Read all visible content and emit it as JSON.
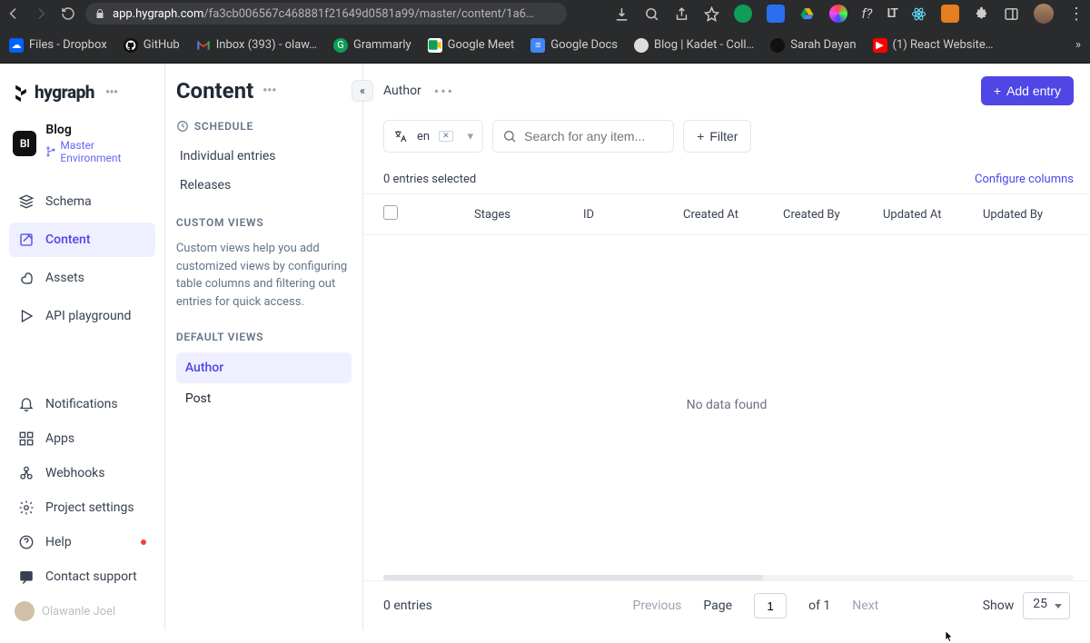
{
  "chrome": {
    "url_host": "app.hygraph.com",
    "url_path": "/fa3cb006567c468881f21649d0581a99/master/content/1a6…"
  },
  "bookmarks": [
    {
      "label": "Files - Dropbox"
    },
    {
      "label": "GitHub"
    },
    {
      "label": "Inbox (393) - olaw…"
    },
    {
      "label": "Grammarly"
    },
    {
      "label": "Google Meet"
    },
    {
      "label": "Google Docs"
    },
    {
      "label": "Blog | Kadet - Coll…"
    },
    {
      "label": "Sarah Dayan"
    },
    {
      "label": "(1) React Website…"
    }
  ],
  "brand": {
    "name": "hygraph"
  },
  "project": {
    "badge": "Bl",
    "name": "Blog",
    "env": "Master Environment"
  },
  "nav": {
    "schema": "Schema",
    "content": "Content",
    "assets": "Assets",
    "api": "API playground",
    "notifications": "Notifications",
    "apps": "Apps",
    "webhooks": "Webhooks",
    "settings": "Project settings",
    "help": "Help",
    "support": "Contact support",
    "user": "Olawanle Joel"
  },
  "panel": {
    "title": "Content",
    "schedule": "SCHEDULE",
    "individual": "Individual entries",
    "releases": "Releases",
    "custom_views": "CUSTOM VIEWS",
    "custom_help": "Custom views help you add customized views by configuring table columns and filtering out entries for quick access.",
    "default_views": "DEFAULT VIEWS",
    "views": {
      "author": "Author",
      "post": "Post"
    }
  },
  "main": {
    "breadcrumb": "Author",
    "add_entry": "Add entry",
    "lang": "en",
    "search_placeholder": "Search for any item...",
    "filter": "Filter",
    "selected_text": "0 entries selected",
    "configure_cols": "Configure columns",
    "columns": {
      "stages": "Stages",
      "id": "ID",
      "created_at": "Created At",
      "created_by": "Created By",
      "updated_at": "Updated At",
      "updated_by": "Updated By"
    },
    "empty": "No data found"
  },
  "footer": {
    "entries": "0 entries",
    "previous": "Previous",
    "page_label": "Page",
    "page": "1",
    "of": "of 1",
    "next": "Next",
    "show": "Show",
    "show_value": "25"
  }
}
